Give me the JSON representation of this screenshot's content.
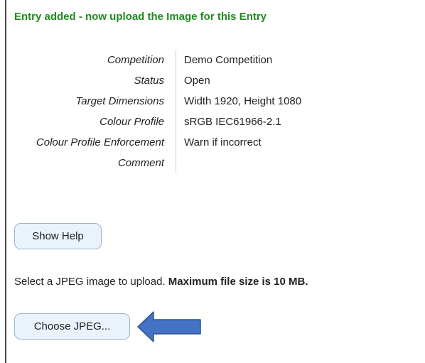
{
  "message": {
    "success": "Entry added - now upload the Image for this Entry"
  },
  "details": [
    {
      "label": "Competition",
      "value": "Demo Competition"
    },
    {
      "label": "Status",
      "value": "Open"
    },
    {
      "label": "Target Dimensions",
      "value": "Width 1920, Height 1080"
    },
    {
      "label": "Colour Profile",
      "value": "sRGB IEC61966-2.1"
    },
    {
      "label": "Colour Profile Enforcement",
      "value": "Warn if incorrect"
    },
    {
      "label": "Comment",
      "value": ""
    }
  ],
  "buttons": {
    "show_help": "Show Help",
    "choose_jpeg": "Choose JPEG..."
  },
  "upload": {
    "instruction": "Select a JPEG image to upload.",
    "max_size": "Maximum file size is 10 MB."
  },
  "colors": {
    "success_text": "#1e8c1e",
    "button_bg": "#eaf2fb",
    "button_border": "#9db4cf",
    "arrow_fill": "#4472c4",
    "arrow_stroke": "#2f528f"
  },
  "icons": {
    "pointer": "arrow-left-icon"
  }
}
